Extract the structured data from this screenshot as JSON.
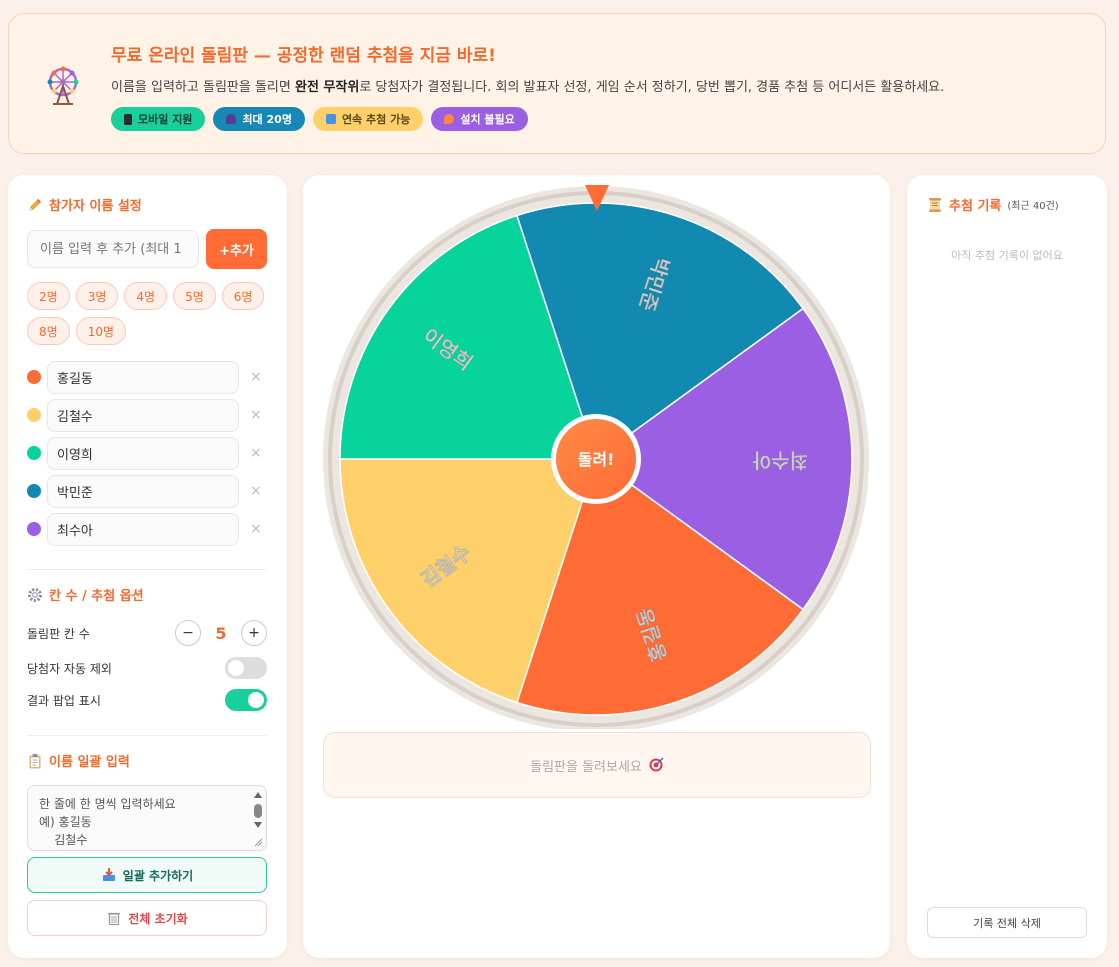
{
  "banner": {
    "title": "무료 온라인 돌림판 — 공정한 랜덤 추첨을 지금 바로!",
    "desc_before": "이름을 입력하고 돌림판을 돌리면 ",
    "desc_bold": "완전 무작위",
    "desc_after": "로 당첨자가 결정됩니다. 회의 발표자 선정, 게임 순서 정하기, 당번 뽑기, 경품 추첨 등 어디서든 활용하세요.",
    "badges": [
      {
        "label": "모바일 지원",
        "icon": "phone-icon",
        "bg": "#19cf9c",
        "fg": "#0b3f32"
      },
      {
        "label": "최대 20명",
        "icon": "person-icon",
        "bg": "#1788b5",
        "fg": "#ffffff"
      },
      {
        "label": "연속 추첨 가능",
        "icon": "repeat-icon",
        "bg": "#fdd06a",
        "fg": "#5a4a1a"
      },
      {
        "label": "설치 불필요",
        "icon": "fire-icon",
        "bg": "#9b5fe3",
        "fg": "#ffffff"
      }
    ]
  },
  "left": {
    "participants_title": "참가자 이름 설정",
    "name_placeholder": "이름 입력 후 추가 (최대 1",
    "add_label": "+추가",
    "presets": [
      "2명",
      "3명",
      "4명",
      "5명",
      "6명",
      "8명",
      "10명"
    ],
    "participants": [
      {
        "name": "홍길동",
        "color": "#ff6b35"
      },
      {
        "name": "김철수",
        "color": "#fdd06a"
      },
      {
        "name": "이영희",
        "color": "#07d49a"
      },
      {
        "name": "박민준",
        "color": "#1289b0"
      },
      {
        "name": "최수아",
        "color": "#9b5fe3"
      }
    ],
    "remove_symbol": "×",
    "options_title": "칸 수 / 추첨 옵션",
    "slots_label": "돌림판 칸 수",
    "slots_value": "5",
    "minus": "−",
    "plus": "+",
    "auto_exclude_label": "당첨자 자동 제외",
    "auto_exclude_on": false,
    "popup_label": "결과 팝업 표시",
    "popup_on": true,
    "bulk_title": "이름 일괄 입력",
    "bulk_placeholder": "한 줄에 한 명씩 입력하세요\n예) 홍길동\n    김철수",
    "bulk_add_label": "일괄 추가하기",
    "reset_label": "전체 초기화"
  },
  "center": {
    "spin_label": "돌려!",
    "result_text": "돌림판을 돌려보세요",
    "result_icon": "target-icon"
  },
  "right": {
    "history_title": "추첨 기록",
    "history_sub": "(최근 40건)",
    "history_empty": "아직 추첨 기록이 없어요",
    "clear_label": "기록 전체 삭제"
  },
  "colors": {
    "accent": "#ff6b35",
    "toggle_on": "#19cf9c",
    "toggle_off": "#dddddd"
  }
}
